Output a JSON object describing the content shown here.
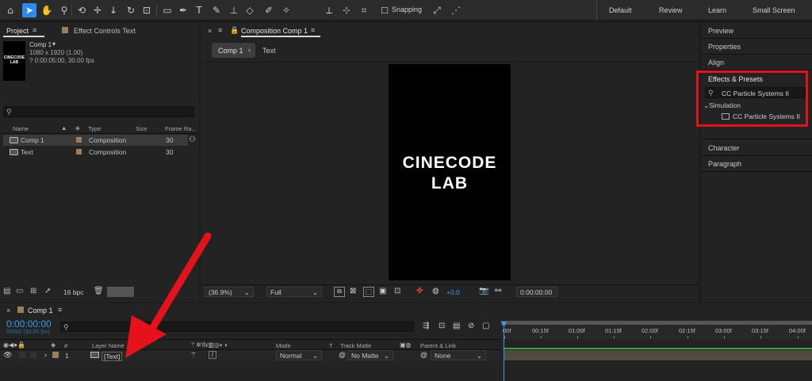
{
  "toolbar": {
    "snapping_label": "Snapping",
    "workspaces": [
      "Default",
      "Review",
      "Learn",
      "Small Screen"
    ]
  },
  "project": {
    "tab_label": "Project",
    "effect_controls_label": "Effect Controls Text",
    "thumb_text": "CINECODE LAB",
    "comp_name": "Comp 1",
    "comp_dims": "1080 x 1920 (1.00)",
    "comp_duration": "? 0:00:05:00, 30.00 fps",
    "columns": [
      "Name",
      "Type",
      "Size",
      "Frame Ra..."
    ],
    "items": [
      {
        "name": "Comp 1",
        "type": "Composition",
        "fps": "30"
      },
      {
        "name": "Text",
        "type": "Composition",
        "fps": "30"
      }
    ],
    "bpc": "16 bpc"
  },
  "viewer": {
    "tab_label": "Composition Comp 1",
    "breadcrumb_active": "Comp 1",
    "breadcrumb_next": "Text",
    "canvas_line1": "CINECODE",
    "canvas_line2": "LAB",
    "zoom": "(36.9%)",
    "resolution": "Full",
    "exposure": "+0.0",
    "timecode": "0:00:00:00"
  },
  "right_panel": {
    "preview": "Preview",
    "properties": "Properties",
    "align": "Align",
    "effects_presets": "Effects & Presets",
    "search_value": "CC Particle Systems II",
    "category": "Simulation",
    "effect_item": "CC Particle Systems II",
    "character": "Character",
    "paragraph": "Paragraph",
    "highlight_color": "#e5121b"
  },
  "timeline": {
    "tab_label": "Comp 1",
    "timecode": "0:00:00:00",
    "fps_label": "00000 (30.00 fps)",
    "headers": {
      "layer_name": "Layer Name",
      "mode": "Mode",
      "t": "T",
      "track_matte": "Track Matte",
      "parent": "Parent & Link"
    },
    "layer": {
      "index": "1",
      "name": "[Text]",
      "mode": "Normal",
      "matte": "No Matte",
      "parent": "None"
    },
    "ruler": [
      "00f",
      "00:15f",
      "01:00f",
      "01:15f",
      "02:00f",
      "02:15f",
      "03:00f",
      "03:15f",
      "04:00f"
    ],
    "accent_color": "#3a9bea"
  },
  "annotation": {
    "arrow_color": "#e5121b"
  }
}
